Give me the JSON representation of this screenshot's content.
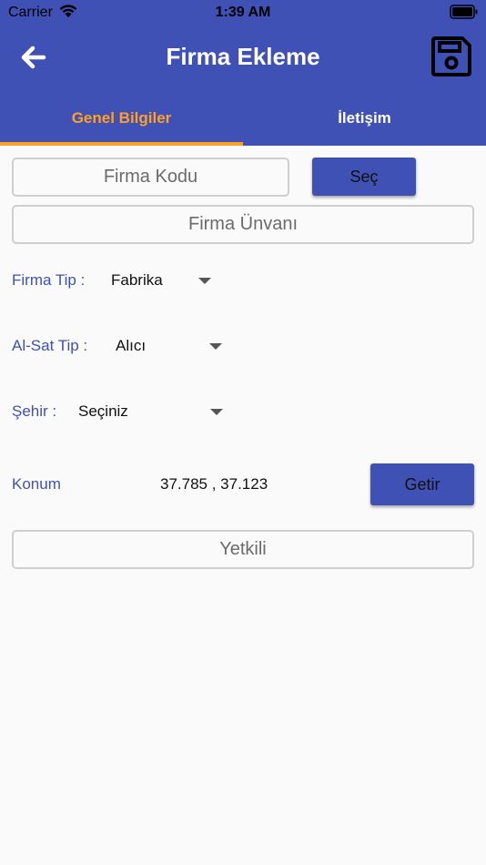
{
  "status_bar": {
    "carrier": "Carrier",
    "time": "1:39 AM"
  },
  "app_bar": {
    "title": "Firma Ekleme",
    "back_icon": "arrow-left-icon",
    "save_icon": "floppy-disk-icon",
    "background_color": "#3f51b5"
  },
  "tabs": [
    {
      "label": "Genel Bilgiler",
      "selected": true,
      "color": "#ff9f2b"
    },
    {
      "label": "İletişim",
      "selected": false,
      "color": "#ffffff"
    }
  ],
  "form": {
    "firma_kodu_placeholder": "Firma Kodu",
    "sec_button": "Seç",
    "firma_unvani_placeholder": "Firma Ünvanı",
    "firma_tip": {
      "label": "Firma Tip :",
      "value": "Fabrika"
    },
    "al_sat_tip": {
      "label": "Al-Sat Tip :",
      "value": "Alıcı"
    },
    "sehir": {
      "label": "Şehir :",
      "value": "Seçiniz"
    },
    "konum": {
      "label": "Konum",
      "value": "37.785 , 37.123",
      "button": "Getir"
    },
    "yetkili_placeholder": "Yetkili"
  }
}
